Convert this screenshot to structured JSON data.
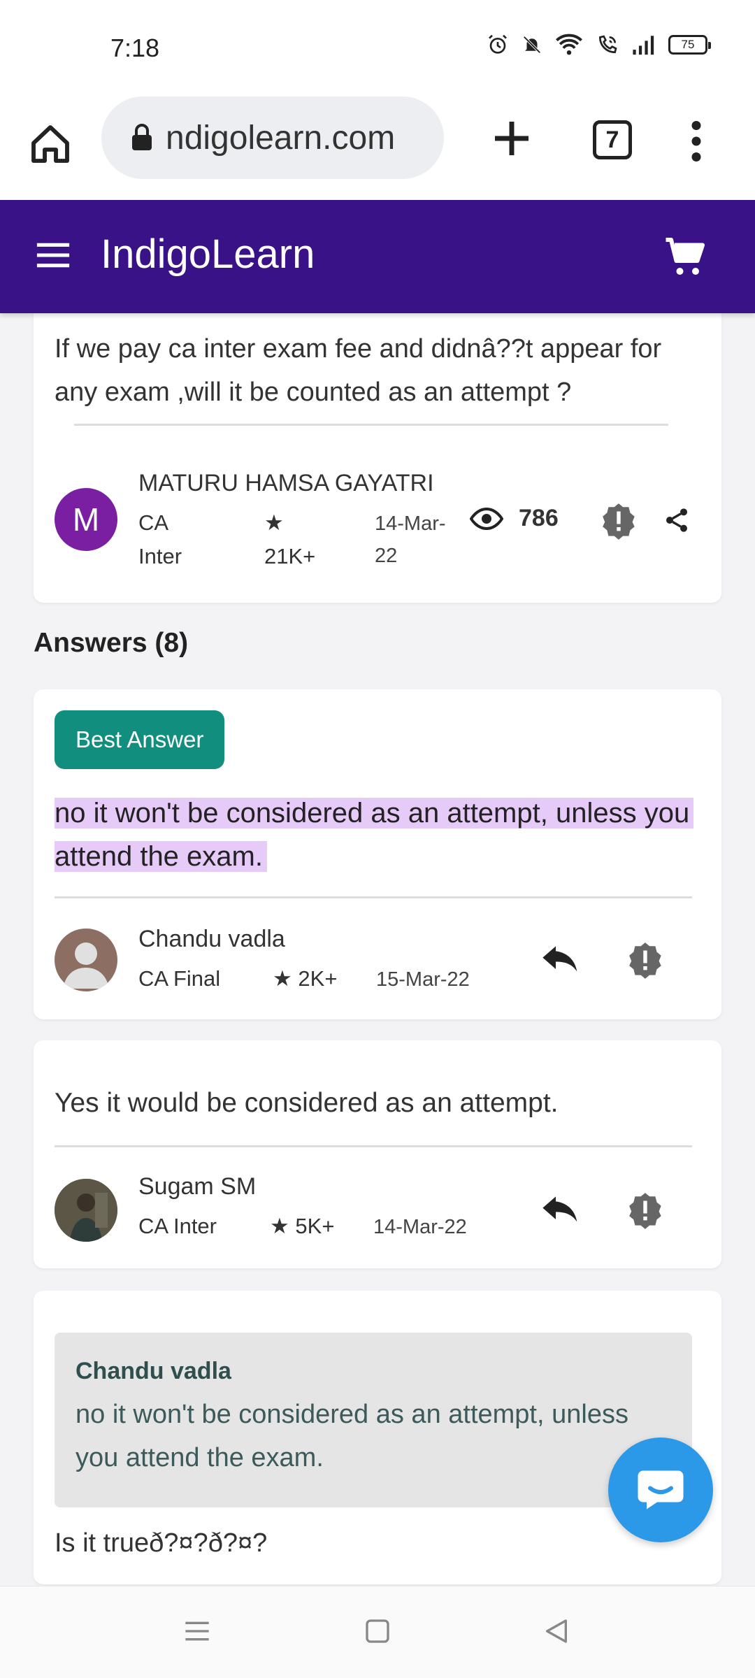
{
  "status_bar": {
    "time": "7:18",
    "battery": "75"
  },
  "browser": {
    "url": "ndigolearn.com",
    "tab_count": "7"
  },
  "app": {
    "brand": "IndigoLearn"
  },
  "question": {
    "text": "If we pay ca inter exam fee and didnâ??t appear for any exam ,will it be counted as an attempt ?",
    "author": "MATURU HAMSA GAYATRI",
    "avatar_letter": "M",
    "level": "CA Inter",
    "level_line1": "CA",
    "level_line2": "Inter",
    "points_line1": "★",
    "points_line2": "21K+",
    "date_line1": "14-Mar-",
    "date_line2": "22",
    "views": "786"
  },
  "answers_title": "Answers (8)",
  "answers": [
    {
      "badge": "Best Answer",
      "text": "no it won't be considered as an attempt, unless you attend the exam.",
      "author": "Chandu vadla",
      "level": "CA Final",
      "points": "★ 2K+",
      "date": "15-Mar-22"
    },
    {
      "text": "Yes it would be considered as an attempt.",
      "author": "Sugam SM",
      "level": "CA Inter",
      "points": "★ 5K+",
      "date": "14-Mar-22"
    },
    {
      "quote_author": "Chandu vadla",
      "quote_text": "no it won't be considered as an attempt, unless you attend the exam.",
      "text": "Is it trueð?¤?ð?¤?"
    }
  ],
  "colors": {
    "header": "#3a1287",
    "best_badge": "#128e7f",
    "highlight": "#e6cbf8",
    "fab": "#2c99e8",
    "avatar_m": "#7b1fa2"
  }
}
